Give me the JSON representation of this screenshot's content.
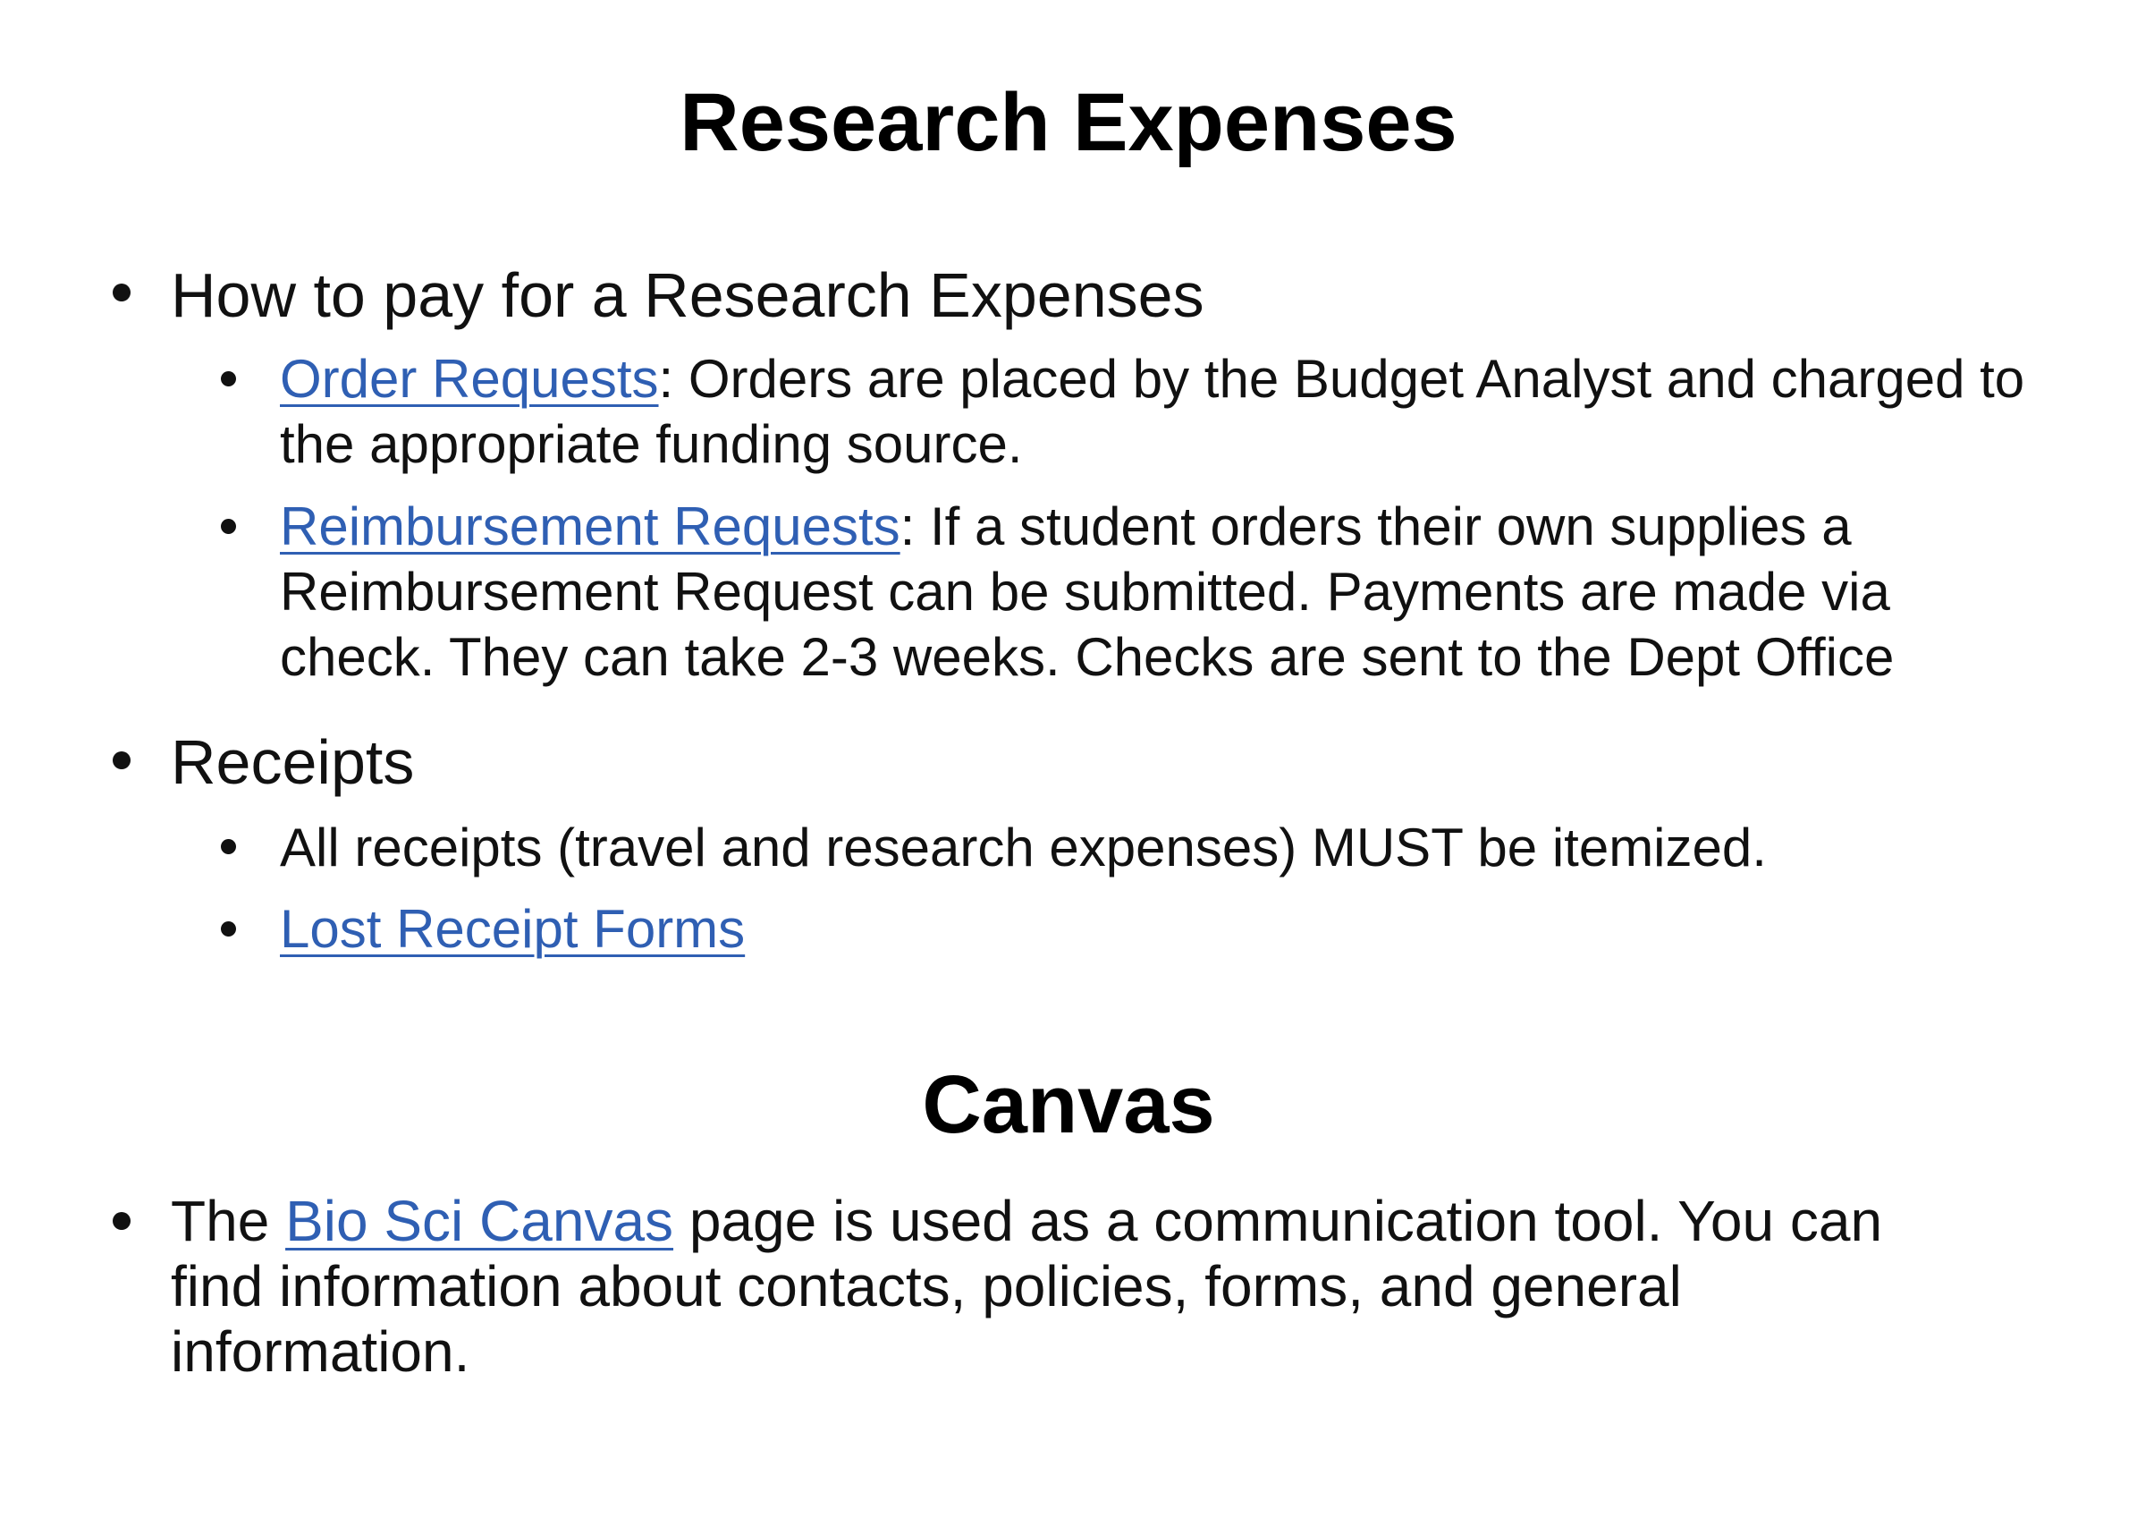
{
  "research": {
    "title": "Research Expenses",
    "items": [
      {
        "text": "How to pay for a Research Expenses",
        "subitems": [
          {
            "link": "Order Requests",
            "text": ": Orders are placed by the Budget Analyst and charged to the appropriate funding source."
          },
          {
            "link": "Reimbursement Requests",
            "text": ": If a student orders their own supplies a Reimbursement Request can be submitted. Payments are made via check. They can take 2-3 weeks. Checks are sent to the Dept Office"
          }
        ]
      },
      {
        "text": "Receipts",
        "subitems": [
          {
            "text": "All receipts (travel and research expenses) MUST be itemized."
          },
          {
            "link": "Lost Receipt Forms"
          }
        ]
      }
    ]
  },
  "canvas": {
    "title": "Canvas",
    "item": {
      "prefix": "The ",
      "link": "Bio Sci Canvas",
      "suffix": " page is used as a communication tool. You can find information about contacts, policies, forms, and general information."
    }
  },
  "colors": {
    "link": "#2f5fb3",
    "text": "#111111"
  }
}
